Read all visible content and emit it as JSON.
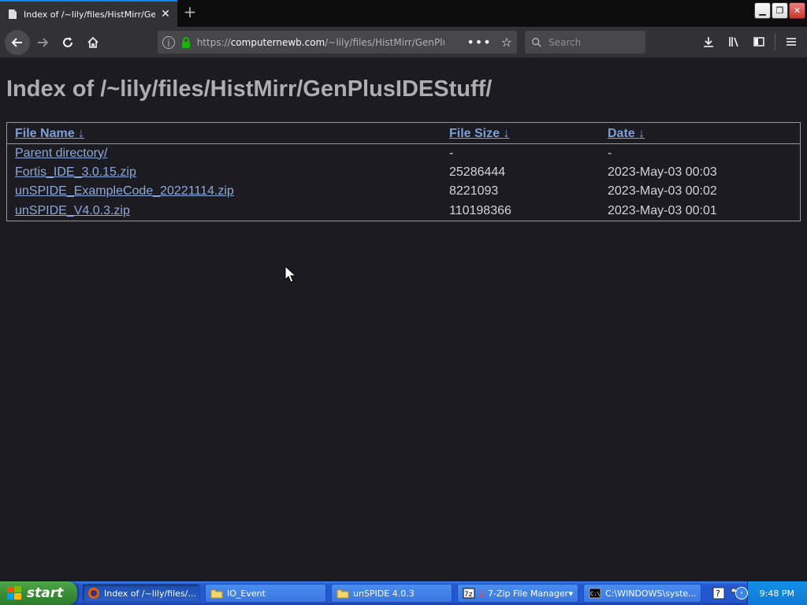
{
  "browser": {
    "tab_title": "Index of /~lily/files/HistMirr/GenPl",
    "tab_close": "✕",
    "new_tab": "+",
    "url_prefix": "https://",
    "url_host": "computernewb.com",
    "url_path": "/~lily/files/HistMirr/GenPlus",
    "page_actions": "•••",
    "bookmark": "☆",
    "search_placeholder": "Search"
  },
  "page": {
    "heading": "Index of /~lily/files/HistMirr/GenPlusIDEStuff/",
    "columns": [
      {
        "label": "File Name",
        "sort": "↓"
      },
      {
        "label": "File Size",
        "sort": "↓"
      },
      {
        "label": "Date",
        "sort": "↓"
      }
    ],
    "rows": [
      {
        "name": "Parent directory/",
        "size": "-",
        "date": "-"
      },
      {
        "name": "Fortis_IDE_3.0.15.zip",
        "size": "25286444",
        "date": "2023-May-03 00:03"
      },
      {
        "name": "unSPIDE_ExampleCode_20221114.zip",
        "size": "8221093",
        "date": "2023-May-03 00:02"
      },
      {
        "name": "unSPIDE_V4.0.3.zip",
        "size": "110198366",
        "date": "2023-May-03 00:01"
      }
    ]
  },
  "taskbar": {
    "start_label": "start",
    "tasks": [
      {
        "label": "Index of /~lily/files/...",
        "icon": "firefox-icon"
      },
      {
        "label": "IO_Event",
        "icon": "folder-icon"
      },
      {
        "label": "unSPIDE 4.0.3",
        "icon": "folder-icon"
      },
      {
        "label": "7-Zip File Manager",
        "icon": "7zip-icon",
        "count": "2"
      },
      {
        "label": "C:\\WINDOWS\\syste...",
        "icon": "cmd-icon"
      }
    ],
    "clock": "9:48 PM"
  }
}
